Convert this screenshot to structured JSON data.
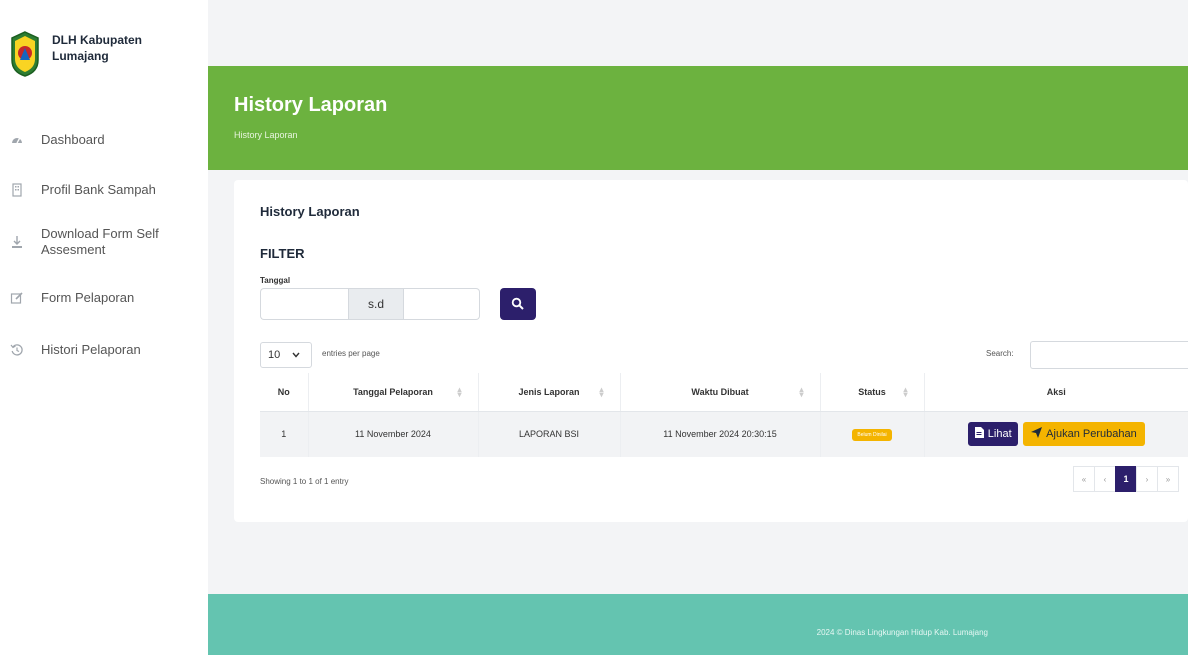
{
  "sidebar": {
    "brand": "DLH Kabupaten Lumajang",
    "items": [
      {
        "label": "Dashboard",
        "icon": "dashboard-gauge-icon"
      },
      {
        "label": "Profil Bank Sampah",
        "icon": "building-icon"
      },
      {
        "label": "Download Form Self Assesment",
        "icon": "download-icon"
      },
      {
        "label": "Form Pelaporan",
        "icon": "edit-icon"
      },
      {
        "label": "Histori Pelaporan",
        "icon": "history-icon"
      }
    ]
  },
  "header": {
    "title": "History Laporan",
    "breadcrumb": "History Laporan"
  },
  "card": {
    "title": "History Laporan",
    "filter_title": "FILTER",
    "tanggal_label": "Tanggal",
    "separator": "s.d"
  },
  "table": {
    "page_length": "10",
    "entries_label": "entries per page",
    "search_label": "Search:",
    "columns": [
      "No",
      "Tanggal Pelaporan",
      "Jenis Laporan",
      "Waktu Dibuat",
      "Status",
      "Aksi"
    ],
    "rows": [
      {
        "no": "1",
        "tanggal": "11 November 2024",
        "jenis": "LAPORAN BSI",
        "waktu": "11 November 2024 20:30:15",
        "status": "Belum Dinilai"
      }
    ],
    "btn_lihat": "Lihat",
    "btn_ajukan": "Ajukan Perubahan",
    "showing": "Showing 1 to 1 of 1 entry",
    "pagination": {
      "first": "«",
      "prev": "‹",
      "current": "1",
      "next": "›",
      "last": "»"
    }
  },
  "footer": {
    "text": "2024 © Dinas Lingkungan Hidup Kab. Lumajang"
  },
  "colors": {
    "hero": "#6cb23f",
    "footer": "#64c4b0",
    "primary": "#2c1f6b",
    "warning": "#f4b400"
  }
}
